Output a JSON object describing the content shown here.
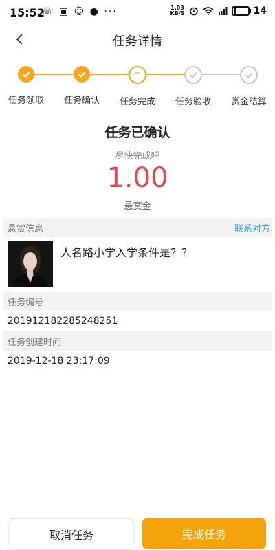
{
  "statusbar": {
    "time": "15:52",
    "left_icons": "☏ ▣ ☺ ● ···",
    "speed_top": "1.03",
    "speed_bottom": "KB/S",
    "battery_text": "14",
    "battery_level": 0.14
  },
  "header": {
    "title": "任务详情"
  },
  "steps": [
    {
      "label": "任务领取",
      "state": "done"
    },
    {
      "label": "任务确认",
      "state": "done"
    },
    {
      "label": "任务完成",
      "state": "current"
    },
    {
      "label": "任务验收",
      "state": "pending"
    },
    {
      "label": "赏金结算",
      "state": "pending"
    }
  ],
  "status": {
    "title": "任务已确认",
    "subtitle": "尽快完成吧",
    "amount": "1.00",
    "amount_label": "悬赏金"
  },
  "reward_info": {
    "header": "悬赏信息",
    "contact_link": "联系对方",
    "question": "人名路小学入学条件是？？"
  },
  "task_number": {
    "header": "任务编号",
    "value": "201912182285248251"
  },
  "task_created": {
    "header": "任务创建时间",
    "value": "2019-12-18 23:17:09"
  },
  "buttons": {
    "cancel": "取消任务",
    "complete": "完成任务"
  },
  "colors": {
    "accent": "#f5a623",
    "amount": "#e0494d",
    "link": "#3aa0e8"
  }
}
